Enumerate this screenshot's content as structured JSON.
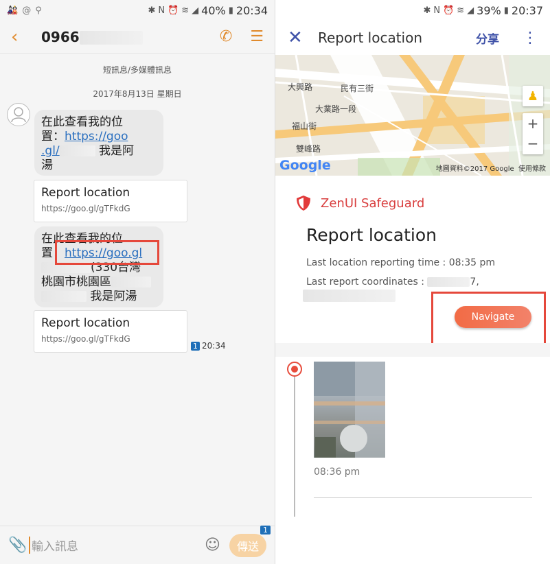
{
  "left": {
    "status": {
      "battery": "40%",
      "time": "20:34"
    },
    "header": {
      "phone_prefix": "0966"
    },
    "sys_line": "短訊息/多媒體訊息",
    "date_line": "2017年8月13日 星期日",
    "msg1": {
      "line1": "在此查看我的位",
      "line2_prefix": "置：",
      "link_a": "https://goo",
      "link_b": ".gl/",
      "suffix": " 我是阿",
      "line4": "湯"
    },
    "card1": {
      "title": "Report location",
      "url": "https://goo.gl/gTFkdG"
    },
    "msg2": {
      "line1": "在此查看我的位",
      "line2_prefix": "置：",
      "link": "https://goo.gl",
      "line3_suffix": "(330台灣",
      "line4": "桃園市桃園區",
      "line5_suffix": " 我是阿湯"
    },
    "card2": {
      "title": "Report location",
      "url": "https://goo.gl/gTFkdG"
    },
    "meta": {
      "count": "1",
      "time": "20:34"
    },
    "composer": {
      "placeholder": "輸入訊息",
      "send": "傳送",
      "send_badge": "1"
    }
  },
  "right": {
    "status": {
      "battery": "39%",
      "time": "20:37"
    },
    "header": {
      "title": "Report location",
      "share": "分享"
    },
    "map": {
      "labels": [
        "大興路",
        "大業路一段",
        "民有三街",
        "福山街",
        "雙峰路"
      ],
      "credit": "地圖資料©2017 Google",
      "terms": "使用條款",
      "logo": "Google"
    },
    "safeguard_brand": "ZenUI Safeguard",
    "card_title": "Report location",
    "report_time": "Last location reporting time : 08:35 pm",
    "report_coords_prefix": "Last report coordinates :",
    "report_coords_suffix": "7,",
    "navigate": "Navigate",
    "photo_time": "08:36 pm"
  },
  "colors": {
    "accent_orange": "#e08a2c",
    "link_blue": "#2a6fbf",
    "indigo": "#3f52a8",
    "highlight_red": "#e5483b",
    "navigate": "#f26b45"
  }
}
